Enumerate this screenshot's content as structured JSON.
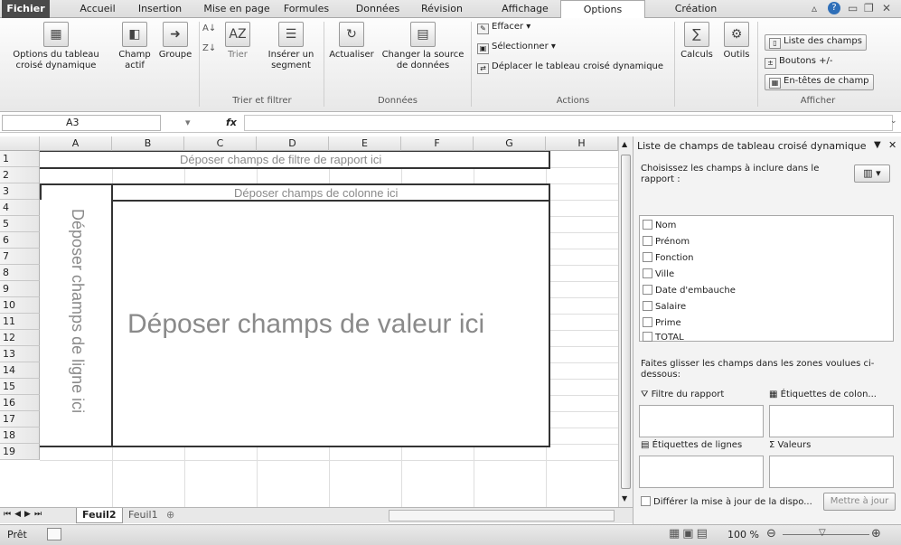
{
  "ribbon_tabs": [
    "Fichier",
    "Accueil",
    "Insertion",
    "Mise en page",
    "Formules",
    "Données",
    "Révision",
    "Affichage",
    "Options",
    "Création"
  ],
  "ribbon": {
    "options_tableau": "Options du tableau croisé dynamique",
    "champ_actif": "Champ actif",
    "groupe": "Groupe",
    "trier": "Trier",
    "inserer_segment": "Insérer un segment",
    "actualiser": "Actualiser",
    "changer_source": "Changer la source de données",
    "effacer": "Effacer",
    "selectionner": "Sélectionner",
    "deplacer": "Déplacer le tableau croisé dynamique",
    "calculs": "Calculs",
    "outils": "Outils",
    "liste_champs": "Liste des champs",
    "boutons": "Boutons +/-",
    "entetes": "En-têtes de champ",
    "groups": {
      "trier_filtrer": "Trier et filtrer",
      "donnees": "Données",
      "actions": "Actions",
      "afficher": "Afficher"
    }
  },
  "formula_bar": {
    "name_box": "A3",
    "fx": "fx",
    "value": ""
  },
  "grid": {
    "columns": [
      "A",
      "B",
      "C",
      "D",
      "E",
      "F",
      "G",
      "H"
    ],
    "rows": [
      "1",
      "2",
      "3",
      "4",
      "5",
      "6",
      "7",
      "8",
      "9",
      "10",
      "11",
      "12",
      "13",
      "14",
      "15",
      "16",
      "17",
      "18",
      "19"
    ],
    "filter_zone": "Déposer champs de filtre de rapport ici",
    "column_zone": "Déposer champs de colonne ici",
    "row_zone": "Déposer champs de ligne ici",
    "value_zone": "Déposer champs de valeur ici"
  },
  "sheets": [
    "Feuil2",
    "Feuil1"
  ],
  "active_sheet": "Feuil2",
  "status": {
    "ready": "Prêt",
    "zoom": "100 %"
  },
  "pane": {
    "title": "Liste de champs de tableau croisé dynamique",
    "choose_label": "Choisissez les champs à inclure dans le rapport :",
    "fields": [
      "Nom",
      "Prénom",
      "Fonction",
      "Ville",
      "Date d'embauche",
      "Salaire",
      "Prime",
      "TOTAL"
    ],
    "drag_label": "Faites glisser les champs dans les zones voulues ci-dessous:",
    "filter_area": "Filtre du rapport",
    "column_area": "Étiquettes de colon...",
    "row_area": "Étiquettes de lignes",
    "values_area": "Valeurs",
    "defer_label": "Différer la mise à jour de la dispo...",
    "update_button": "Mettre à jour"
  }
}
